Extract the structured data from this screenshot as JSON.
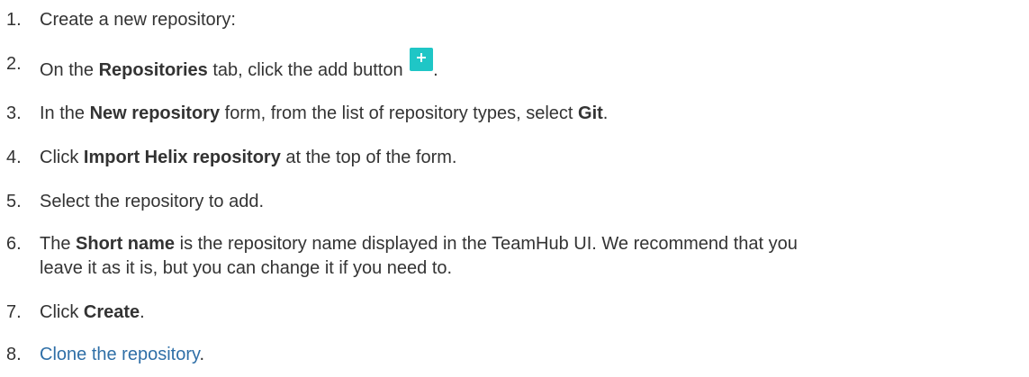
{
  "steps": [
    {
      "number": "1.",
      "text": "Create a new repository:"
    },
    {
      "number": "2.",
      "pre": "On the ",
      "bold": "Repositories",
      "post": " tab, click the add button",
      "icon": "plus-icon",
      "end": ".",
      "button_color": "#1fc6c6"
    },
    {
      "number": "3.",
      "pre": "In the ",
      "bold1": "New repository",
      "mid": " form, from the list of repository types, select ",
      "bold2": "Git",
      "end": "."
    },
    {
      "number": "4.",
      "pre": "Click ",
      "bold": "Import Helix repository",
      "post": " at the top of the form."
    },
    {
      "number": "5.",
      "text": "Select the repository to add."
    },
    {
      "number": "6.",
      "pre": "The ",
      "bold": "Short name",
      "post_line1": " is the repository name displayed in the TeamHub UI. We recommend that you",
      "line2": "leave it as it is, but you can change it if you need to."
    },
    {
      "number": "7.",
      "pre": "Click ",
      "bold": "Create",
      "end": "."
    },
    {
      "number": "8.",
      "link": "Clone the repository",
      "end": ".",
      "link_color": "#2f6fa7"
    }
  ]
}
